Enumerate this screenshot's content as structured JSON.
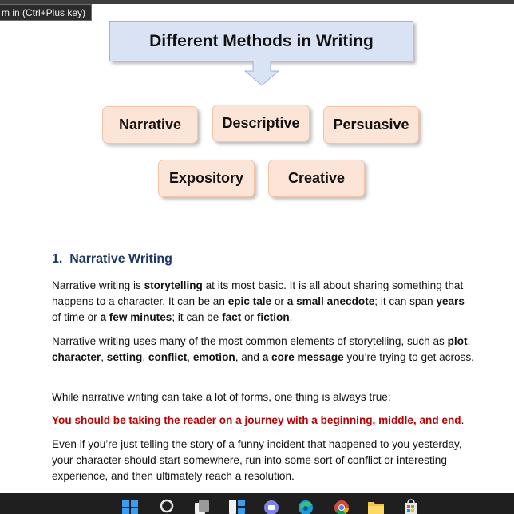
{
  "tooltip": {
    "text": "m in (Ctrl+Plus key)"
  },
  "diagram": {
    "title": "Different Methods in Writing",
    "methods": [
      "Narrative",
      "Descriptive",
      "Persuasive",
      "Expository",
      "Creative"
    ]
  },
  "article": {
    "heading": "1.  Narrative Writing",
    "p1": {
      "a": "Narrative writing is ",
      "b": "storytelling",
      "c": " at its most basic. It is all about sharing something that happens to a character. It can be an ",
      "d": "epic tale",
      "e": " or ",
      "f": "a small anecdote",
      "g": "; it can span ",
      "h": "years",
      "i": " of time or ",
      "j": "a few minutes",
      "k": "; it can be ",
      "l": "fact",
      "m": " or ",
      "n": "fiction",
      "o": "."
    },
    "p2": {
      "a": "Narrative writing uses many of the most common elements of storytelling, such as ",
      "b": "plot",
      "c": ", ",
      "d": "character",
      "e": ", ",
      "f": "setting",
      "g": ", ",
      "h": "conflict",
      "i": ", ",
      "j": "emotion",
      "k": ", and ",
      "l": "a core message",
      "m": " you’re trying to get across."
    },
    "p3": "While narrative writing can take a lot of forms, one thing is always true:",
    "p4": "You should be taking the reader on a journey with a beginning, middle, and end",
    "p4_end": ".",
    "p5": "Even if you’re just telling the story of a funny incident that happened to you yesterday, your character should start somewhere, run into some sort of conflict or interesting experience, and then ultimately reach a resolution."
  },
  "taskbar": {
    "icons": [
      "windows-start-icon",
      "search-icon",
      "task-view-icon",
      "widgets-icon",
      "teams-chat-icon",
      "edge-browser-icon",
      "chrome-browser-icon",
      "file-explorer-icon",
      "store-icon"
    ]
  },
  "colors": {
    "title_box_fill": "#dae3f3",
    "method_box_fill": "#fce5d6",
    "heading": "#1f3864",
    "highlight": "#c00000"
  }
}
